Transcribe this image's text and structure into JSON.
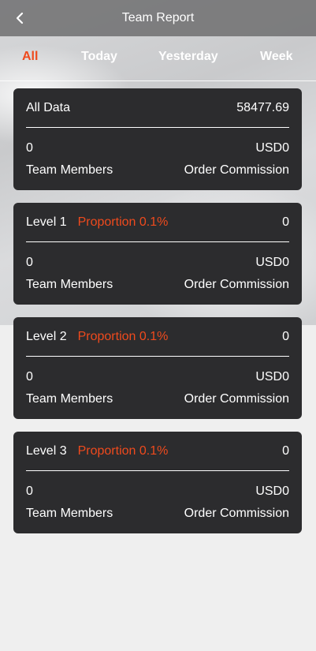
{
  "header": {
    "title": "Team Report",
    "back_icon": "chevron-left-icon"
  },
  "tabs": [
    {
      "label": "All",
      "active": true
    },
    {
      "label": "Today",
      "active": false
    },
    {
      "label": "Yesterday",
      "active": false
    },
    {
      "label": "Week",
      "active": false
    }
  ],
  "cards": [
    {
      "title": "All Data",
      "proportion": "",
      "total": "58477.69",
      "members_value": "0",
      "commission_value": "USD0",
      "members_label": "Team Members",
      "commission_label": "Order Commission"
    },
    {
      "title": "Level 1",
      "proportion": "Proportion 0.1%",
      "total": "0",
      "members_value": "0",
      "commission_value": "USD0",
      "members_label": "Team Members",
      "commission_label": "Order Commission"
    },
    {
      "title": "Level 2",
      "proportion": "Proportion 0.1%",
      "total": "0",
      "members_value": "0",
      "commission_value": "USD0",
      "members_label": "Team Members",
      "commission_label": "Order Commission"
    },
    {
      "title": "Level 3",
      "proportion": "Proportion 0.1%",
      "total": "0",
      "members_value": "0",
      "commission_value": "USD0",
      "members_label": "Team Members",
      "commission_label": "Order Commission"
    }
  ],
  "colors": {
    "accent": "#ef4a1d",
    "card_bg": "#2c2c2e",
    "page_bg": "#efefef"
  }
}
